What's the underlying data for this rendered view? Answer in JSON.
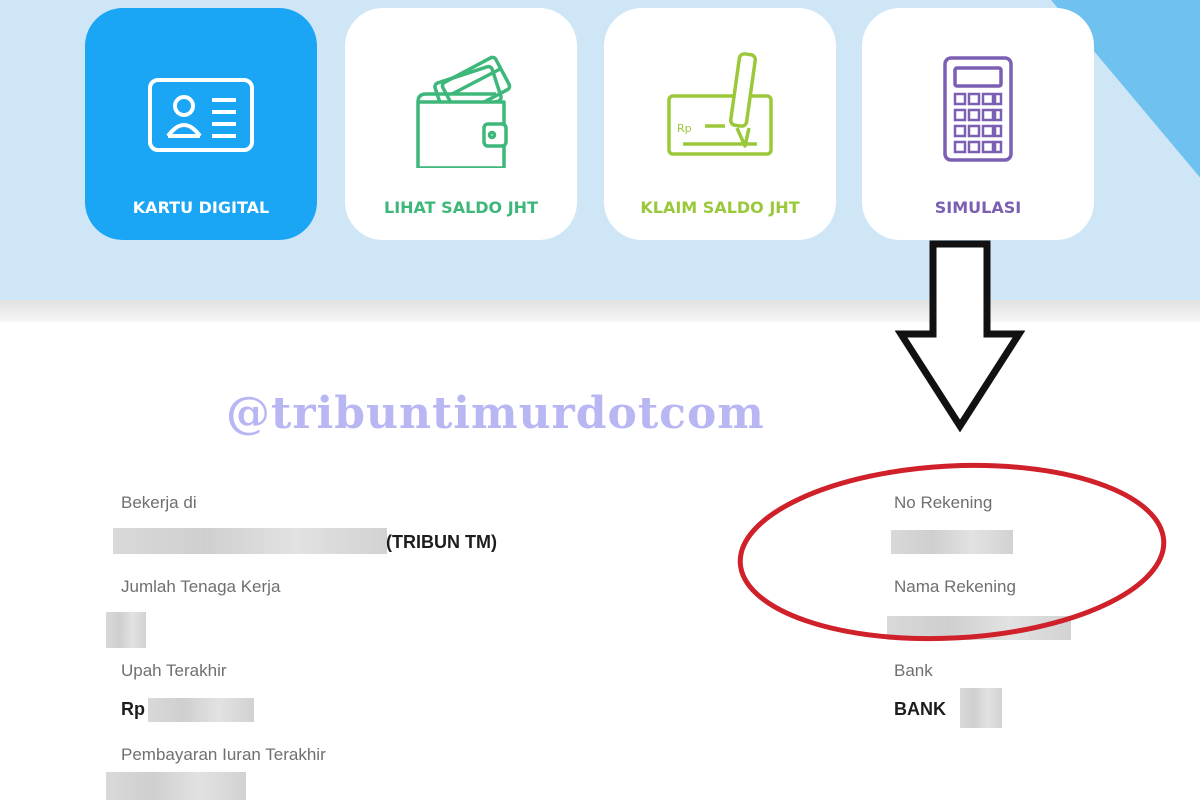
{
  "menu": {
    "items": [
      {
        "label": "KARTU DIGITAL",
        "icon": "id-card-icon",
        "active": true,
        "color": "#ffffff"
      },
      {
        "label": "LIHAT SALDO JHT",
        "icon": "wallet-icon",
        "active": false,
        "color": "#3eb77a"
      },
      {
        "label": "KLAIM SALDO JHT",
        "icon": "cheque-pen-icon",
        "active": false,
        "color": "#9bc83a"
      },
      {
        "label": "SIMULASI",
        "icon": "calculator-icon",
        "active": false,
        "color": "#7b5fb3"
      }
    ],
    "cheque_currency": "Rp"
  },
  "watermark": "@tribuntimurdotcom",
  "details": {
    "bekerja_di_label": "Bekerja di",
    "bekerja_di_value": "(TRIBUN TM)",
    "jumlah_tenaga_kerja_label": "Jumlah Tenaga Kerja",
    "upah_terakhir_label": "Upah Terakhir",
    "upah_terakhir_value": "Rp",
    "pembayaran_iuran_label": "Pembayaran Iuran Terakhir",
    "no_rekening_label": "No Rekening",
    "nama_rekening_label": "Nama Rekening",
    "bank_label": "Bank",
    "bank_value": "BANK"
  },
  "annotation": {
    "arrow_icon": "down-arrow-icon",
    "highlight": "red-ellipse",
    "highlight_color": "#d0202a"
  },
  "colors": {
    "top_panel": "#cfe6f6",
    "active_card": "#1aa6f5"
  }
}
